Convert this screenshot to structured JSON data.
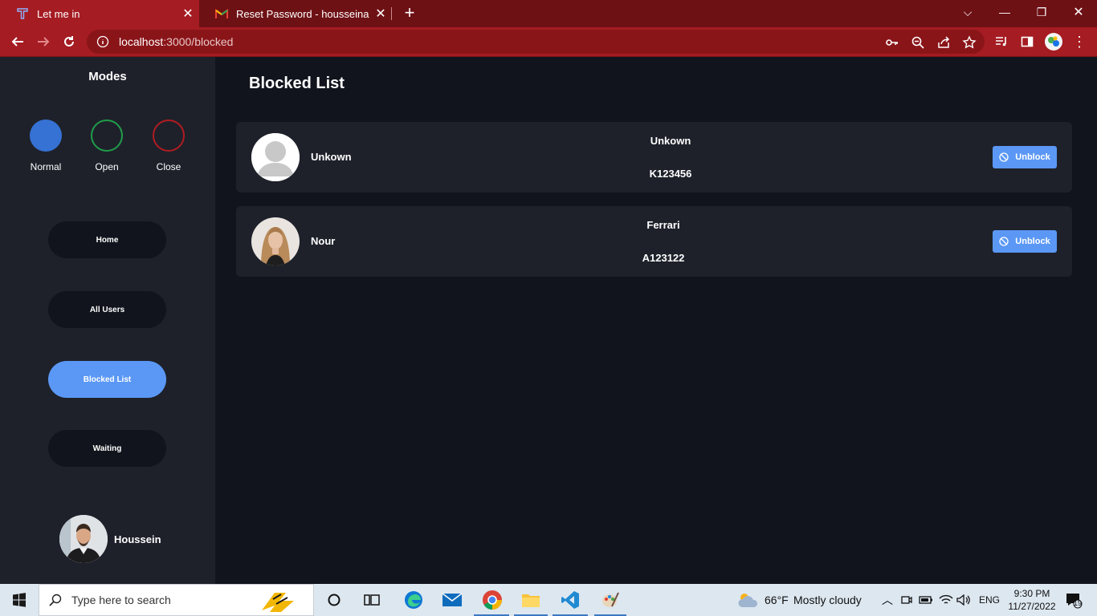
{
  "browser": {
    "tabs": [
      {
        "title": "Let me in",
        "active": true
      },
      {
        "title": "Reset Password - housseinalialdroubi",
        "active": false
      }
    ],
    "url_host": "localhost",
    "url_path": ":3000/blocked"
  },
  "sidebar": {
    "modes_title": "Modes",
    "modes": [
      {
        "label": "Normal",
        "color": "#3572d4"
      },
      {
        "label": "Open",
        "color": "#1f9d4a"
      },
      {
        "label": "Close",
        "color": "#b01c22"
      }
    ],
    "nav": [
      {
        "label": "Home",
        "active": false
      },
      {
        "label": "All Users",
        "active": false
      },
      {
        "label": "Blocked List",
        "active": true
      },
      {
        "label": "Waiting",
        "active": false
      }
    ],
    "profile_name": "Houssein"
  },
  "main": {
    "title": "Blocked List",
    "blocked": [
      {
        "name": "Unkown",
        "car": "Unkown",
        "plate": "K123456",
        "button": "Unblock",
        "avatar": "default-avatar"
      },
      {
        "name": "Nour",
        "car": "Ferrari",
        "plate": "A123122",
        "button": "Unblock",
        "avatar": "photo-avatar"
      }
    ]
  },
  "taskbar": {
    "search_placeholder": "Type here to search",
    "weather_temp": "66°F",
    "weather_text": "Mostly cloudy",
    "language": "ENG",
    "time": "9:30 PM",
    "date": "11/27/2022",
    "notification_count": "19"
  },
  "colors": {
    "accent": "#5b98f5",
    "sidebar_bg": "#1e212a",
    "main_bg": "#11141c",
    "chrome_red": "#a51c22"
  }
}
